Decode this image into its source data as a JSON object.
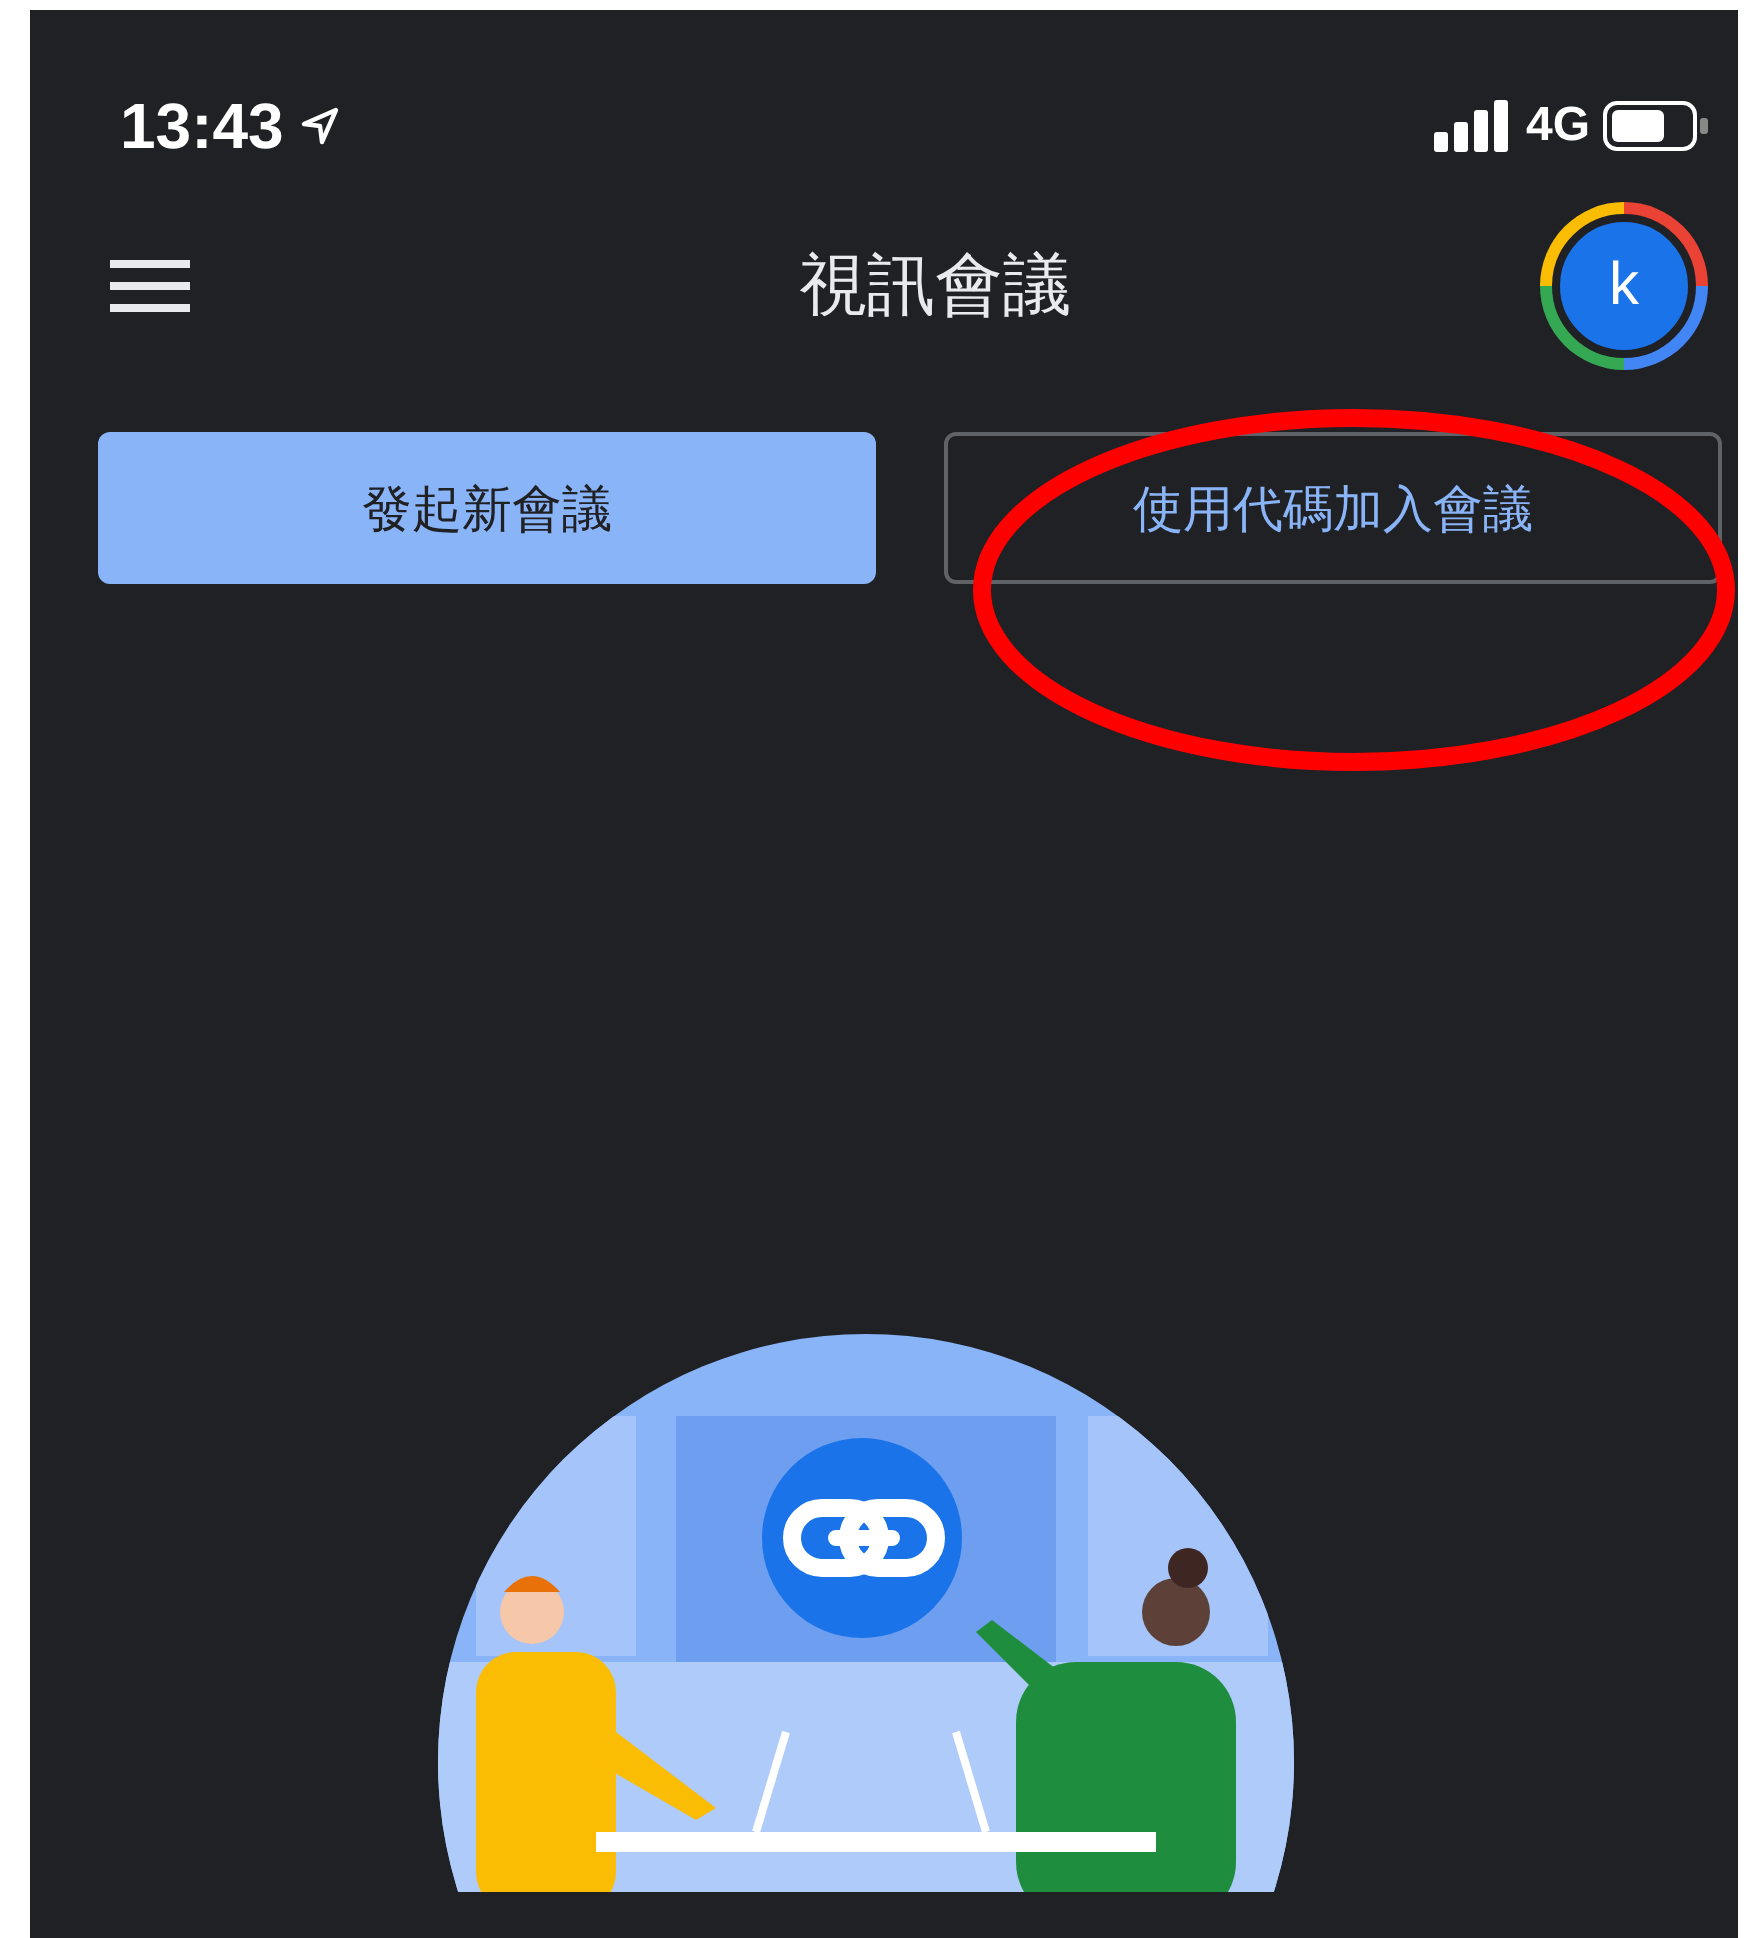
{
  "status_bar": {
    "time": "13:43",
    "network": "4G"
  },
  "header": {
    "title": "視訊會議",
    "avatar_letter": "k"
  },
  "buttons": [
    {
      "label": "發起新會議",
      "kind": "filled"
    },
    {
      "label": "使用代碼加入會議",
      "kind": "outlined"
    }
  ],
  "annotation": {
    "kind": "ellipse"
  }
}
